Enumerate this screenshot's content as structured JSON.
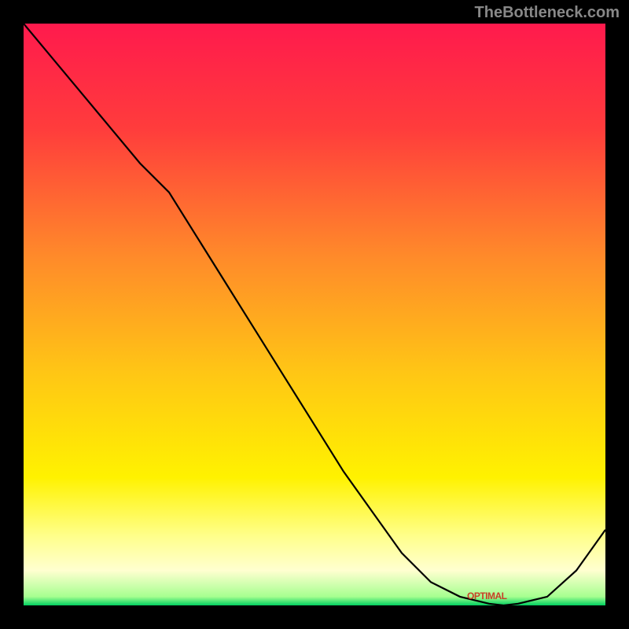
{
  "watermark": "TheBottleneck.com",
  "chart_data": {
    "type": "line",
    "x": [
      0,
      0.05,
      0.1,
      0.15,
      0.2,
      0.25,
      0.3,
      0.35,
      0.4,
      0.45,
      0.5,
      0.55,
      0.6,
      0.65,
      0.7,
      0.75,
      0.8,
      0.825,
      0.85,
      0.9,
      0.95,
      1.0
    ],
    "values": [
      1.0,
      0.94,
      0.88,
      0.82,
      0.76,
      0.71,
      0.63,
      0.55,
      0.47,
      0.39,
      0.31,
      0.23,
      0.16,
      0.09,
      0.04,
      0.015,
      0.003,
      0.0,
      0.003,
      0.015,
      0.06,
      0.13
    ],
    "title": "",
    "xlabel": "",
    "ylabel": "",
    "xlim": [
      0,
      1
    ],
    "ylim": [
      0,
      1
    ],
    "gradient": {
      "type": "vertical",
      "stops": [
        {
          "pos": 0.0,
          "color": "#ff1a4d"
        },
        {
          "pos": 0.18,
          "color": "#ff3c3c"
        },
        {
          "pos": 0.4,
          "color": "#ff8a2a"
        },
        {
          "pos": 0.6,
          "color": "#ffc615"
        },
        {
          "pos": 0.78,
          "color": "#fff200"
        },
        {
          "pos": 0.88,
          "color": "#ffff8a"
        },
        {
          "pos": 0.94,
          "color": "#ffffd0"
        },
        {
          "pos": 0.985,
          "color": "#a6ff90"
        },
        {
          "pos": 1.0,
          "color": "#00d060"
        }
      ]
    },
    "optimal_band": {
      "x_start": 0.72,
      "x_end": 0.88,
      "label": "OPTIMAL"
    }
  }
}
